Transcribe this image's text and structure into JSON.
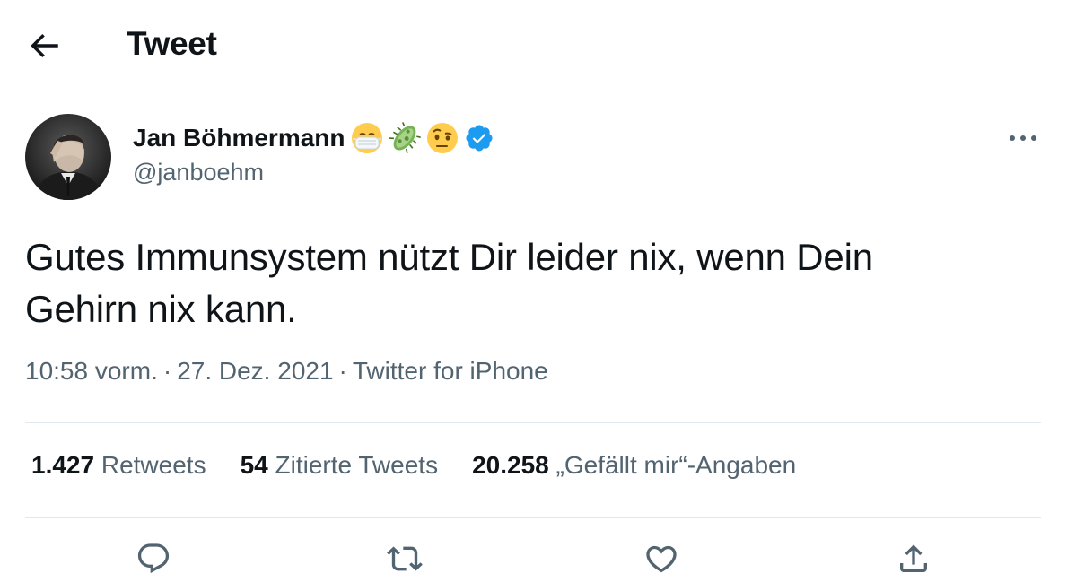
{
  "header": {
    "title": "Tweet",
    "back_icon": "arrow-left-icon"
  },
  "author": {
    "display_name": "Jan Böhmermann",
    "handle": "@janboehm",
    "name_emojis": [
      "mask-face-emoji",
      "microbe-emoji",
      "raised-eyebrow-face-emoji"
    ],
    "verified": true,
    "verified_color": "#1d9bf0"
  },
  "tweet": {
    "text_lines": [
      "Gutes Immunsystem nützt Dir leider nix, wenn Dein",
      "Gehirn nix kann."
    ],
    "time": "10:58 vorm.",
    "date": "27. Dez. 2021",
    "source": "Twitter for iPhone",
    "separator": "·"
  },
  "stats": {
    "retweets": {
      "count": "1.427",
      "label": "Retweets"
    },
    "quotes": {
      "count": "54",
      "label": "Zitierte Tweets"
    },
    "likes": {
      "count": "20.258",
      "label": "„Gefällt mir“-Angaben"
    }
  },
  "actions": {
    "reply_icon": "reply-icon",
    "retweet_icon": "retweet-icon",
    "like_icon": "heart-icon",
    "share_icon": "share-icon"
  },
  "colors": {
    "text": "#0f1419",
    "secondary": "#536471",
    "divider": "#e1e8ed"
  }
}
